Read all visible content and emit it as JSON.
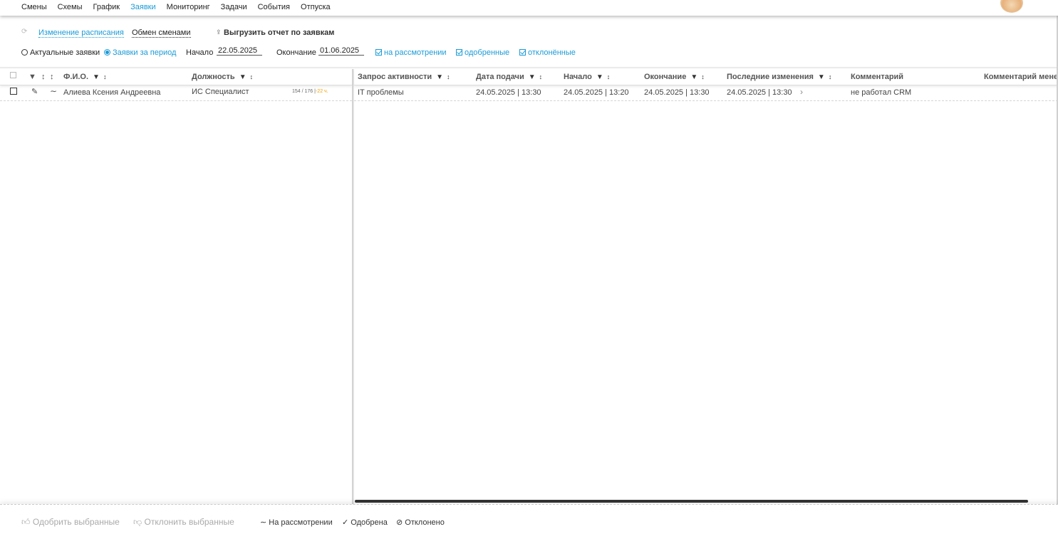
{
  "nav": {
    "items": [
      "Смены",
      "Схемы",
      "График",
      "Заявки",
      "Мониторинг",
      "Задачи",
      "События",
      "Отпуска"
    ],
    "active": "Заявки"
  },
  "toolbar": {
    "schedule_change": "Изменение расписания",
    "shift_exchange": "Обмен сменами",
    "export_report": "Выгрузить отчет по заявкам",
    "current_requests": "Актуальные заявки",
    "period_requests": "Заявки за период",
    "start_label": "Начало",
    "start_value": "22.05.2025",
    "end_label": "Окончание",
    "end_value": "01.06.2025",
    "filter_review": "на рассмотрении",
    "filter_approved": "одобренные",
    "filter_rejected": "отклонённые"
  },
  "table": {
    "left_headers": {
      "name": "Ф.И.О.",
      "position": "Должность"
    },
    "right_headers": {
      "activity": "Запрос активности",
      "submitted": "Дата подачи",
      "start": "Начало",
      "end": "Окончание",
      "last_changes": "Последние изменения",
      "comment": "Комментарий",
      "manager_comment": "Комментарий менед"
    },
    "rows": [
      {
        "name": "Алиева Ксения Андреевна",
        "position": "ИС Специалист",
        "hours": "154 / 176 |",
        "hours_extra": "-22 ч.",
        "activity": "IT проблемы",
        "submitted": "24.05.2025 | 13:30",
        "start": "24.05.2025 | 13:20",
        "end": "24.05.2025 | 13:30",
        "last_changes": "24.05.2025 | 13:30",
        "comment": "не работал CRM"
      }
    ]
  },
  "footer": {
    "approve_selected": "Одобрить выбранные",
    "reject_selected": "Отклонить выбранные",
    "status_review": "На рассмотрении",
    "status_approved": "Одобрена",
    "status_rejected": "Отклонено"
  }
}
